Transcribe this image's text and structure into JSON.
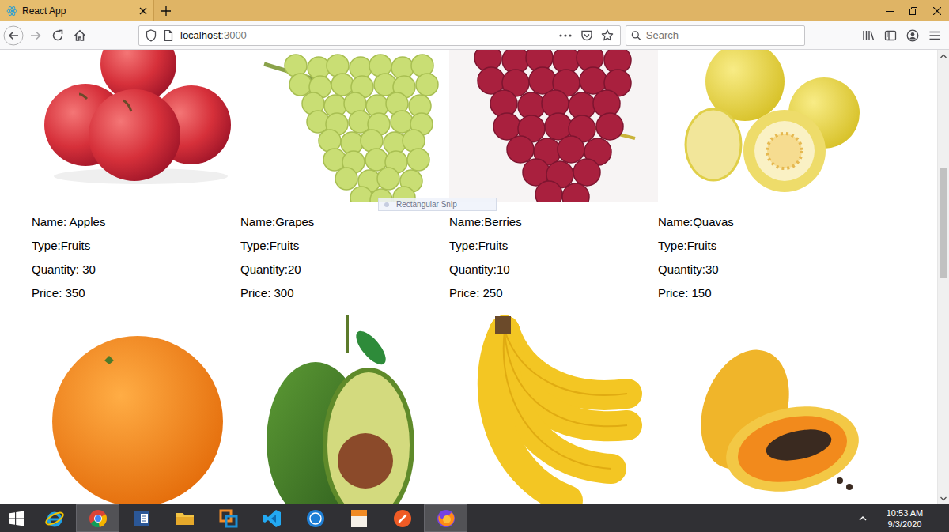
{
  "window": {
    "title": "React App"
  },
  "tabs": [
    {
      "label": "React App",
      "selected": true
    }
  ],
  "address": {
    "host": "localhost",
    "port": ":3000"
  },
  "search": {
    "placeholder": "Search"
  },
  "snip": {
    "label": "Rectangular Snip"
  },
  "products": [
    {
      "fields": [
        "Name: Apples",
        "Type:Fruits",
        "Quantity: 30",
        "Price: 350"
      ]
    },
    {
      "fields": [
        "Name:Grapes",
        "Type:Fruits",
        "Quantity:20",
        "Price: 300"
      ]
    },
    {
      "fields": [
        "Name:Berries",
        "Type:Fruits",
        "Quantity:10",
        "Price: 250"
      ]
    },
    {
      "fields": [
        "Name:Quavas",
        "Type:Fruits",
        "Quantity:30",
        "Price: 150"
      ]
    },
    {
      "fields": []
    },
    {
      "fields": []
    },
    {
      "fields": []
    },
    {
      "fields": []
    }
  ],
  "scrollbar": {
    "level": 0.33
  },
  "taskbar": {
    "apps": [
      {
        "kind": "ie",
        "selected": false
      },
      {
        "kind": "chrome",
        "selected": true
      },
      {
        "kind": "word",
        "selected": false
      },
      {
        "kind": "explorer",
        "selected": false
      },
      {
        "kind": "vmware",
        "selected": false
      },
      {
        "kind": "vscode",
        "selected": false
      },
      {
        "kind": "imo",
        "selected": false
      },
      {
        "kind": "fusion",
        "selected": false
      },
      {
        "kind": "postman",
        "selected": false
      },
      {
        "kind": "firefox",
        "selected": true
      }
    ],
    "time": "10:53 AM",
    "date": "9/3/2020"
  }
}
